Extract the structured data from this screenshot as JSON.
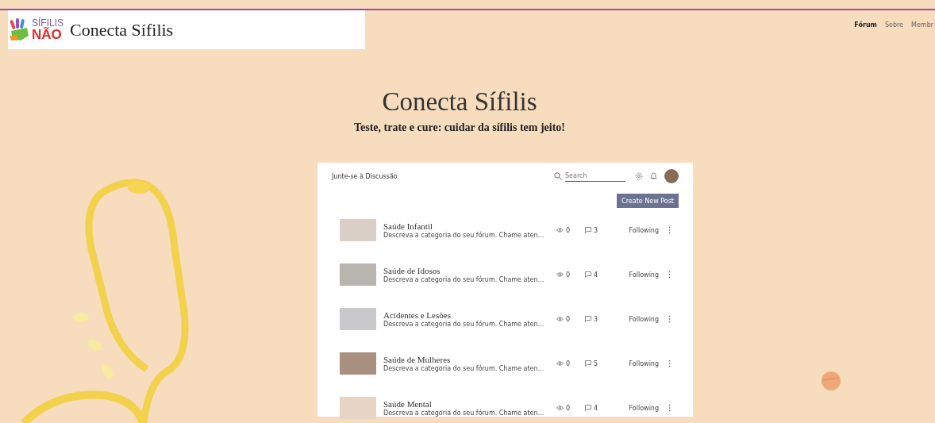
{
  "header": {
    "logo": {
      "top": "SÍFILIS",
      "bottom": "NÃO"
    },
    "site_title": "Conecta Sífilis"
  },
  "nav": [
    {
      "label": "Fórum",
      "selected": true
    },
    {
      "label": "Sobre",
      "selected": false
    },
    {
      "label": "Membr",
      "selected": false
    }
  ],
  "hero": {
    "title": "Conecta Sífilis",
    "subtitle": "Teste, trate e cure: cuidar da sífilis tem jeito!"
  },
  "forum": {
    "title": "Junte-se à Discussão",
    "search": {
      "placeholder": "Search"
    },
    "create_button": "Create New Post",
    "categories": [
      {
        "name": "Saúde Infantil",
        "description": "Descreva a categoria do seu fórum. Chame aten…",
        "views": "0",
        "comments": "3",
        "follow": "Following"
      },
      {
        "name": "Saúde de Idosos",
        "description": "Descreva a categoria do seu fórum. Chame aten…",
        "views": "0",
        "comments": "4",
        "follow": "Following"
      },
      {
        "name": "Acidentes e Lesões",
        "description": "Descreva a categoria do seu fórum. Chame aten…",
        "views": "0",
        "comments": "3",
        "follow": "Following"
      },
      {
        "name": "Saúde de Mulheres",
        "description": "Descreva a categoria do seu fórum. Chame aten…",
        "views": "0",
        "comments": "5",
        "follow": "Following"
      },
      {
        "name": "Saúde Mental",
        "description": "Descreva a categoria do seu fórum. Chame aten…",
        "views": "0",
        "comments": "4",
        "follow": "Following"
      }
    ]
  }
}
